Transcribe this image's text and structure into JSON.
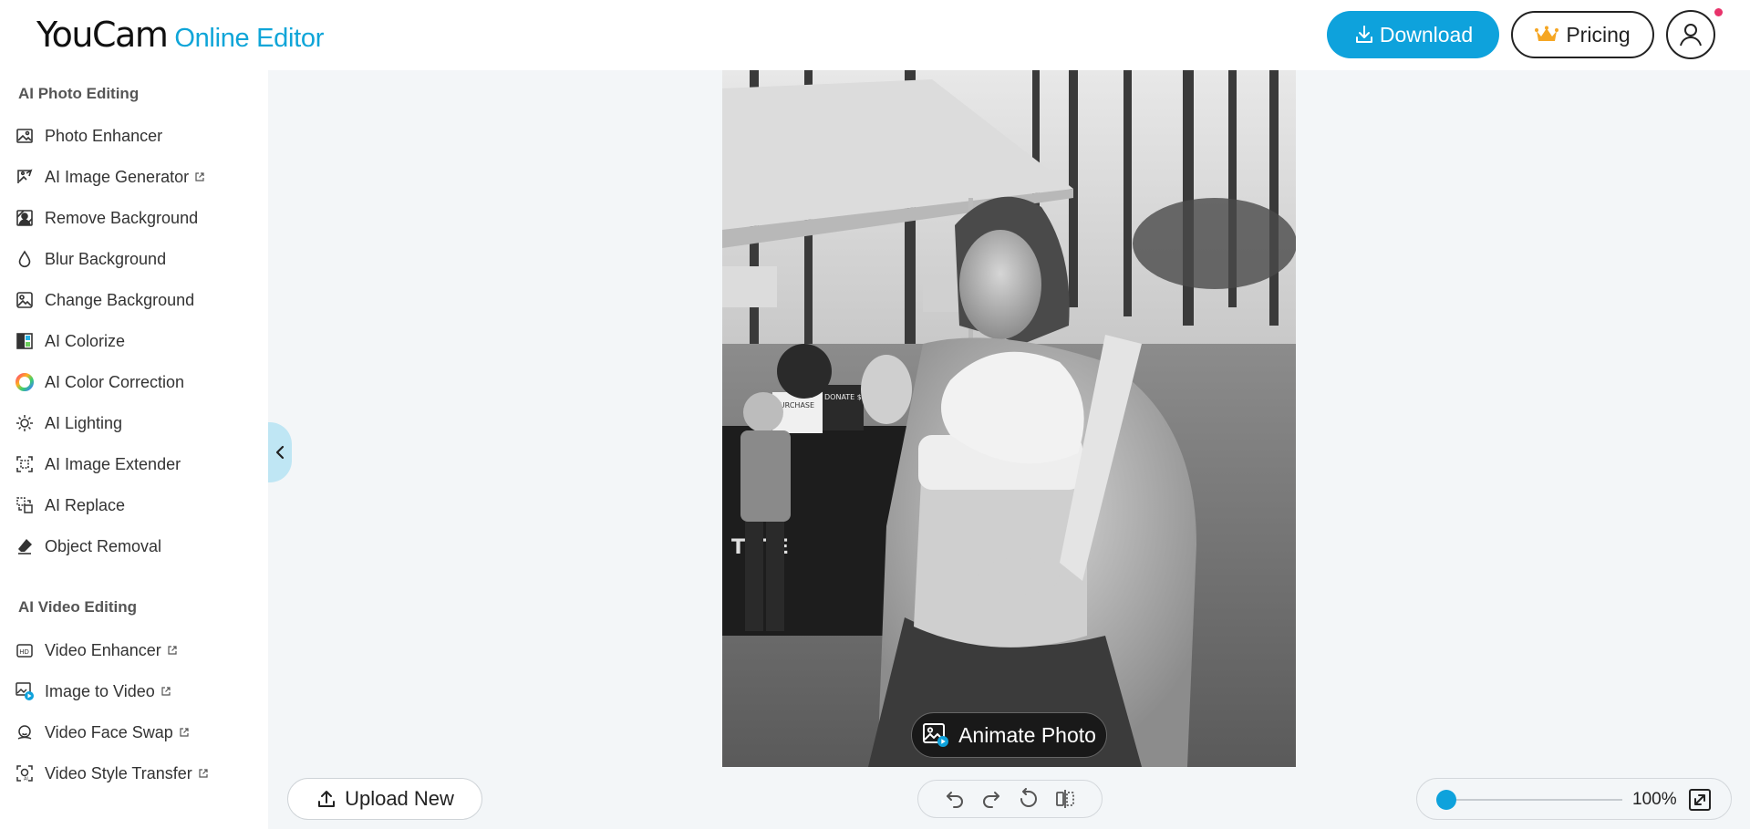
{
  "header": {
    "logo_main": "YouCam",
    "logo_sub": "Online Editor",
    "download_label": "Download",
    "pricing_label": "Pricing"
  },
  "sidebar": {
    "photo_section_title": "AI Photo Editing",
    "photo_items": [
      {
        "label": "Photo Enhancer",
        "icon": "photo-enhancer-icon",
        "external": false
      },
      {
        "label": "AI Image Generator",
        "icon": "ai-image-generator-icon",
        "external": true
      },
      {
        "label": "Remove Background",
        "icon": "remove-background-icon",
        "external": false
      },
      {
        "label": "Blur Background",
        "icon": "blur-drop-icon",
        "external": false
      },
      {
        "label": "Change Background",
        "icon": "change-background-icon",
        "external": false
      },
      {
        "label": "AI Colorize",
        "icon": "colorize-icon",
        "external": false
      },
      {
        "label": "AI Color Correction",
        "icon": "color-wheel-icon",
        "external": false
      },
      {
        "label": "AI Lighting",
        "icon": "lightbulb-icon",
        "external": false
      },
      {
        "label": "AI Image Extender",
        "icon": "image-extender-icon",
        "external": false
      },
      {
        "label": "AI Replace",
        "icon": "ai-replace-icon",
        "external": false
      },
      {
        "label": "Object Removal",
        "icon": "eraser-icon",
        "external": false
      }
    ],
    "video_section_title": "AI Video Editing",
    "video_items": [
      {
        "label": "Video Enhancer",
        "icon": "hd-video-icon",
        "external": true
      },
      {
        "label": "Image to Video",
        "icon": "image-to-video-icon",
        "external": true
      },
      {
        "label": "Video Face Swap",
        "icon": "face-swap-icon",
        "external": true
      },
      {
        "label": "Video Style Transfer",
        "icon": "style-transfer-icon",
        "external": true
      }
    ]
  },
  "canvas": {
    "animate_label": "Animate Photo",
    "photo_sign_text": "TUTE",
    "photo_card_1": "PURCHASE",
    "photo_card_2": "DONATE $1"
  },
  "bottom_bar": {
    "upload_label": "Upload New",
    "zoom_value": "100%",
    "zoom_level": 0.0
  },
  "colors": {
    "accent": "#0ea2dc",
    "logo_sub": "#0fa5d8",
    "workspace_bg": "#f3f6f8",
    "notify_dot": "#e8336b"
  }
}
